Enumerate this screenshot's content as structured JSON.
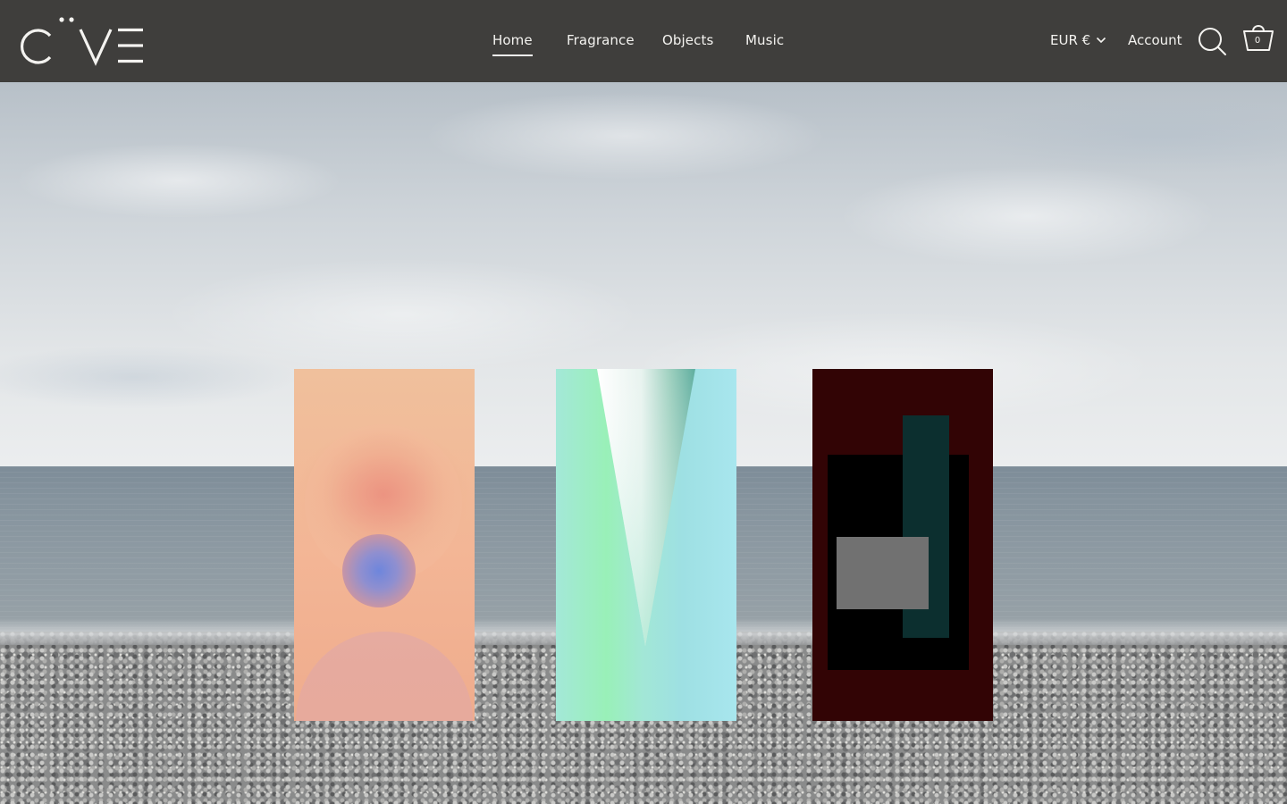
{
  "brand": {
    "name": "CAVE"
  },
  "nav": {
    "items": [
      {
        "label": "Home",
        "active": true
      },
      {
        "label": "Fragrance",
        "active": false
      },
      {
        "label": "Objects",
        "active": false
      },
      {
        "label": "Music",
        "active": false
      }
    ]
  },
  "header": {
    "currency_label": "EUR €",
    "account_label": "Account",
    "cart_count": "0",
    "search_icon": "search-icon",
    "cart_icon": "cart-icon"
  },
  "hero": {
    "products": [
      {
        "name": "fragrance-panel-peach",
        "colors": [
          "#f0c09c",
          "#ec9682",
          "#6e84d8"
        ]
      },
      {
        "name": "fragrance-panel-mint",
        "colors": [
          "#a4e8d8",
          "#99f0b8",
          "#5fae9f"
        ]
      },
      {
        "name": "fragrance-panel-maroon",
        "colors": [
          "#320405",
          "#000000",
          "#0c2f2f",
          "#717171"
        ]
      }
    ]
  },
  "theme": {
    "header_bg": "#3f3e3c",
    "header_text": "#f4f3f0"
  }
}
